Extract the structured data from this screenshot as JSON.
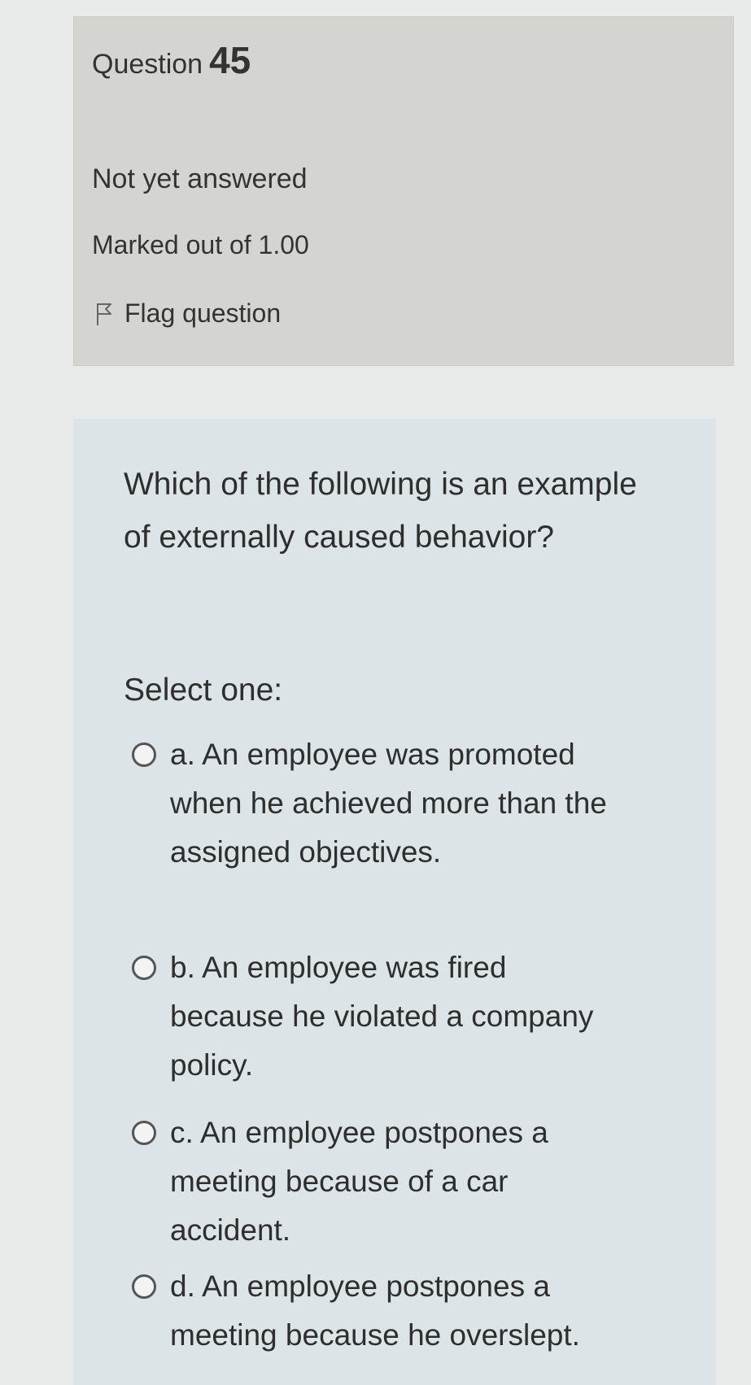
{
  "question": {
    "label": "Question",
    "number": "45",
    "state": "Not yet answered",
    "grade": "Marked out of 1.00",
    "flag_label": "Flag question"
  },
  "content": {
    "question_text": "Which of the following is an example of externally caused behavior?",
    "prompt": "Select one:",
    "answers": [
      {
        "label": "a. An employee was promoted when he achieved more than the assigned objectives.",
        "selected": false
      },
      {
        "label": "b. An employee was fired because he violated a company policy.",
        "selected": false
      },
      {
        "label": "c. An employee postpones a meeting because of a car accident.",
        "selected": false
      },
      {
        "label": "d. An employee postpones a meeting because he overslept.",
        "selected": false
      }
    ]
  },
  "icons": {
    "flag": "flag-outline-icon",
    "radio": "radio-unchecked-icon"
  },
  "colors": {
    "info_panel_bg": "#d4d4d1",
    "content_panel_bg": "#dde4e8",
    "page_bg": "#e9ebea",
    "text": "#2e2e2e"
  }
}
